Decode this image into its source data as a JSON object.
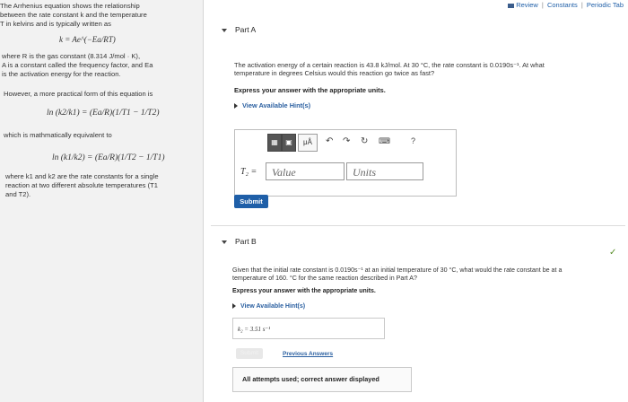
{
  "topbar": {
    "review": "Review",
    "constants": "Constants",
    "periodic": "Periodic Tab"
  },
  "left": {
    "intro1": "The Arrhenius equation shows the relationship",
    "intro2": "between the rate constant k and the temperature",
    "intro3": "T in kelvins and is typically written as",
    "arrhenius": "k = Ae^(−Ea/RT)",
    "where1": "where R is the gas constant (8.314 J/mol · K),",
    "where2": "A is a constant called the frequency factor, and Ea",
    "where3": "is the activation energy for the reaction.",
    "however": "However, a more practical form of this equation is",
    "eq2": "ln (k2/k1) = (Ea/R)(1/T1 − 1/T2)",
    "equiv": "which is mathmatically equivalent to",
    "eq3": "ln (k1/k2) = (Ea/R)(1/T2 − 1/T1)",
    "where4": "where k1 and k2 are the rate constants for a single",
    "where5": "reaction at two different absolute temperatures (T1",
    "where6": "and T2)."
  },
  "partA": {
    "header": "Part A",
    "q1": "The activation energy of a certain reaction is 43.8 kJ/mol. At 30 °C, the rate constant is 0.0190s⁻¹. At what",
    "q2": "temperature in degrees Celsius would this reaction go twice as fast?",
    "instr": "Express your answer with the appropriate units.",
    "hint": "View Available Hint(s)",
    "var": "T₂ =",
    "value_ph": "Value",
    "units_ph": "Units",
    "submit": "Submit",
    "toolbar_mu": "μÅ",
    "toolbar_help": "?"
  },
  "partB": {
    "header": "Part B",
    "q1": "Given that the initial rate constant is 0.0190s⁻¹ at an initial temperature of 30 °C, what would the rate constant be at a",
    "q2": "temperature of 160. °C for the same reaction described in Part A?",
    "instr": "Express your answer with the appropriate units.",
    "hint": "View Available Hint(s)",
    "answer": "k₂ = 3.51 s⁻¹",
    "submit": "Submit",
    "prev": "Previous Answers",
    "status": "All attempts used; correct answer displayed"
  }
}
